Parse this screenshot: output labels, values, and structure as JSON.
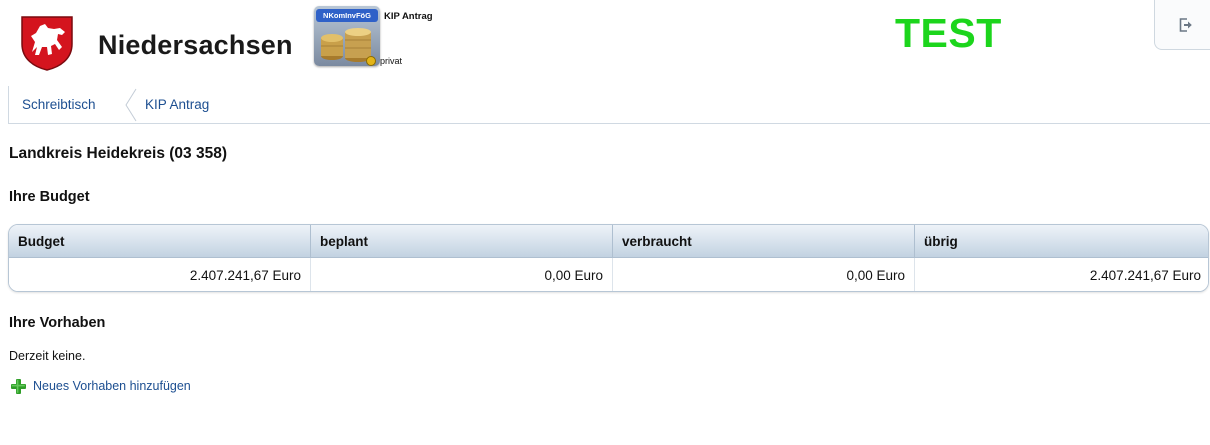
{
  "header": {
    "state_name": "Niedersachsen",
    "app_icon_tag": "NKomInvFöG",
    "app_title": "KIP Antrag",
    "app_user": "privat",
    "test_label": "TEST",
    "test_color": "#1cd51c",
    "logout_icon": "logout-icon"
  },
  "breadcrumb": {
    "items": [
      {
        "label": "Schreibtisch"
      },
      {
        "label": "KIP Antrag"
      }
    ]
  },
  "main": {
    "title": "Landkreis Heidekreis (03 358)",
    "budget_heading": "Ihre Budget",
    "budget_table": {
      "headers": [
        "Budget",
        "beplant",
        "verbraucht",
        "übrig"
      ],
      "row": [
        "2.407.241,67 Euro",
        "0,00 Euro",
        "0,00 Euro",
        "2.407.241,67 Euro"
      ]
    },
    "projects_heading": "Ihre Vorhaben",
    "empty_text": "Derzeit keine.",
    "add_link": "Neues Vorhaben hinzufügen",
    "add_icon": "plus-icon"
  },
  "colors": {
    "link": "#1d4f91",
    "table_header": "#d6e1ec",
    "crest_red": "#d4141e"
  }
}
